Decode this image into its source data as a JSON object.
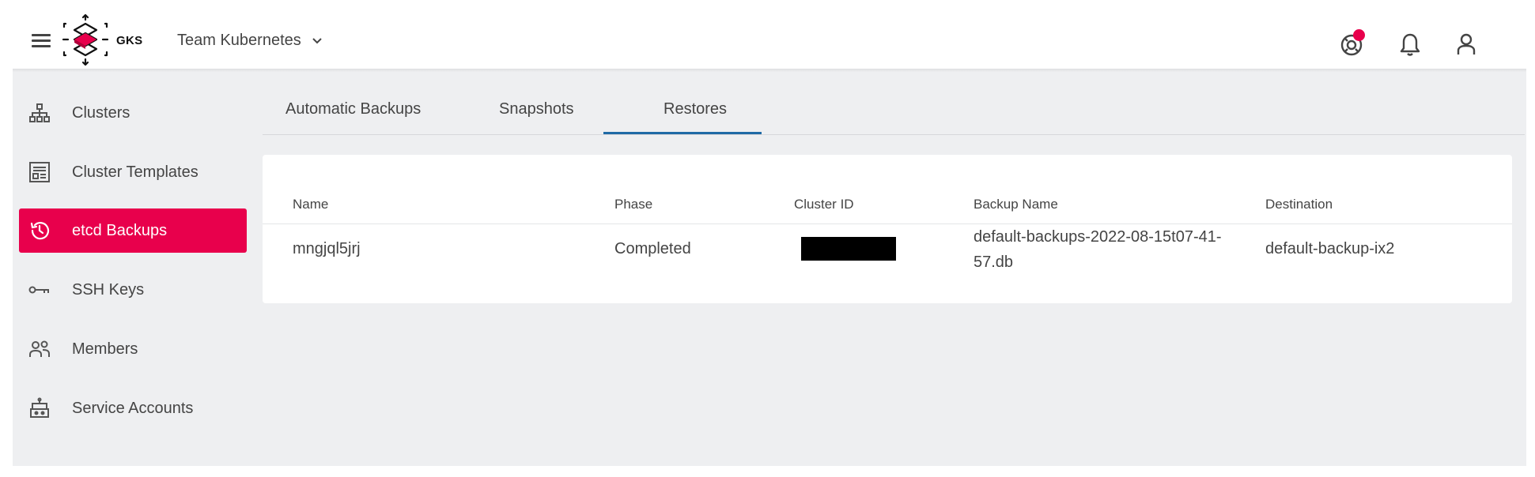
{
  "header": {
    "brand": "GKS",
    "team_name": "Team Kubernetes",
    "icons": [
      "help-icon",
      "bell-icon",
      "user-icon"
    ],
    "notification_color": "#e8004c"
  },
  "sidebar": {
    "items": [
      {
        "label": "Clusters",
        "icon": "sitemap-icon",
        "active": false
      },
      {
        "label": "Cluster Templates",
        "icon": "template-icon",
        "active": false
      },
      {
        "label": "etcd Backups",
        "icon": "history-icon",
        "active": true
      },
      {
        "label": "SSH Keys",
        "icon": "key-icon",
        "active": false
      },
      {
        "label": "Members",
        "icon": "members-icon",
        "active": false
      },
      {
        "label": "Service Accounts",
        "icon": "robot-icon",
        "active": false
      }
    ],
    "accent_color": "#e8004c"
  },
  "tabs": {
    "items": [
      {
        "label": "Automatic Backups"
      },
      {
        "label": "Snapshots"
      },
      {
        "label": "Restores"
      }
    ],
    "active": "Restores",
    "underline_color": "#1f6aa5"
  },
  "table": {
    "columns": [
      "Name",
      "Phase",
      "Cluster ID",
      "Backup Name",
      "Destination"
    ],
    "rows": [
      {
        "name": "mngjql5jrj",
        "phase": "Completed",
        "cluster_id": "",
        "backup_name_line1": "default-backups-2022-08-15t07-41-",
        "backup_name_line2": "57.db",
        "destination": "default-backup-ix2"
      }
    ]
  }
}
